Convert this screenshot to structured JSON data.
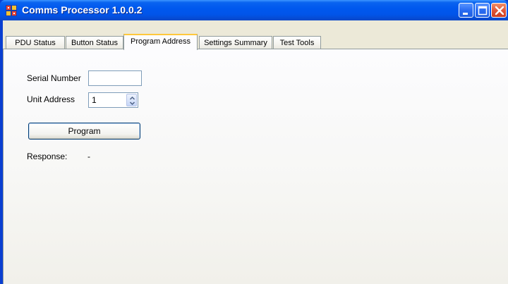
{
  "window": {
    "title": "Comms Processor 1.0.0.2"
  },
  "tabs": [
    {
      "label": "PDU Status",
      "active": false
    },
    {
      "label": "Button Status",
      "active": false
    },
    {
      "label": "Program Address",
      "active": true
    },
    {
      "label": "Settings Summary",
      "active": false
    },
    {
      "label": "Test Tools",
      "active": false
    }
  ],
  "form": {
    "serial_number_label": "Serial Number",
    "serial_number_value": "",
    "unit_address_label": "Unit Address",
    "unit_address_value": "1",
    "program_button": "Program",
    "response_label": "Response:",
    "response_value": "-"
  },
  "colors": {
    "titlebar": "#0058ee",
    "active_tab_highlight": "#ffc83c",
    "client_background": "#ece9d8",
    "close_button": "#e0583a"
  },
  "icons": {
    "app": "app-icon",
    "minimize": "minimize-icon",
    "maximize": "maximize-icon",
    "close": "close-icon",
    "spin_up": "chevron-up-icon",
    "spin_down": "chevron-down-icon"
  }
}
